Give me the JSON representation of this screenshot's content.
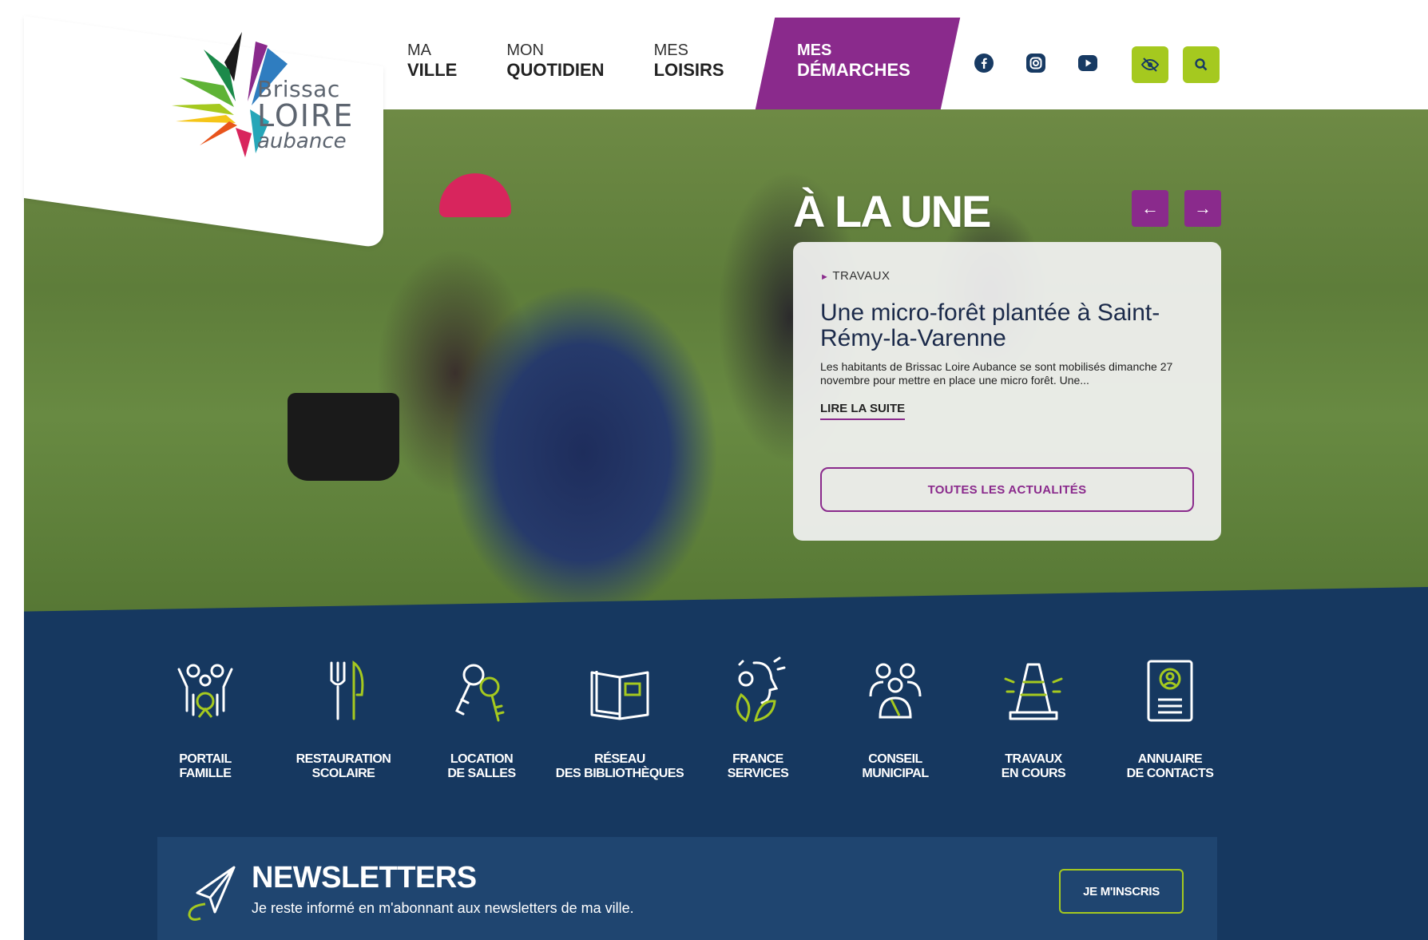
{
  "brand": {
    "line1": "Brissac",
    "line2": "LOIRE",
    "line3": "aubance"
  },
  "nav": [
    {
      "top": "MA",
      "bottom": "VILLE"
    },
    {
      "top": "MON",
      "bottom": "QUOTIDIEN"
    },
    {
      "top": "MES",
      "bottom": "LOISIRS"
    }
  ],
  "nav_active": {
    "top": "MES",
    "bottom": "DÉMARCHES"
  },
  "header_icons": [
    "facebook-icon",
    "instagram-icon",
    "youtube-icon",
    "accessibility-eye-icon",
    "search-icon"
  ],
  "hero": {
    "title": "À LA UNE",
    "prev_label": "←",
    "next_label": "→",
    "card": {
      "category": "TRAVAUX",
      "title": "Une micro-forêt plantée à Saint-Rémy-la-Varenne",
      "excerpt": "Les habitants de Brissac Loire Aubance se sont mobilisés dimanche 27 novembre pour mettre en place une micro forêt. Une...",
      "read_more": "LIRE LA SUITE",
      "all_news": "TOUTES LES ACTUALITÉS"
    }
  },
  "quick_links": [
    {
      "line1": "PORTAIL",
      "line2": "FAMILLE",
      "icon": "family-icon"
    },
    {
      "line1": "RESTAURATION",
      "line2": "SCOLAIRE",
      "icon": "fork-knife-icon"
    },
    {
      "line1": "LOCATION",
      "line2": "DE SALLES",
      "icon": "keys-icon"
    },
    {
      "line1": "RÉSEAU",
      "line2": "DES BIBLIOTHÈQUES",
      "icon": "book-icon"
    },
    {
      "line1": "FRANCE",
      "line2": "SERVICES",
      "icon": "france-services-icon"
    },
    {
      "line1": "CONSEIL",
      "line2": "MUNICIPAL",
      "icon": "council-icon"
    },
    {
      "line1": "TRAVAUX",
      "line2": "EN COURS",
      "icon": "traffic-cone-icon"
    },
    {
      "line1": "ANNUAIRE",
      "line2": "DE CONTACTS",
      "icon": "contact-book-icon"
    }
  ],
  "newsletter": {
    "title": "NEWSLETTERS",
    "subtitle": "Je reste informé en m'abonnant aux newsletters de ma ville.",
    "button": "JE M'INSCRIS"
  },
  "colors": {
    "purple": "#8a2a8c",
    "navy": "#163860",
    "lime": "#a5c91f"
  }
}
